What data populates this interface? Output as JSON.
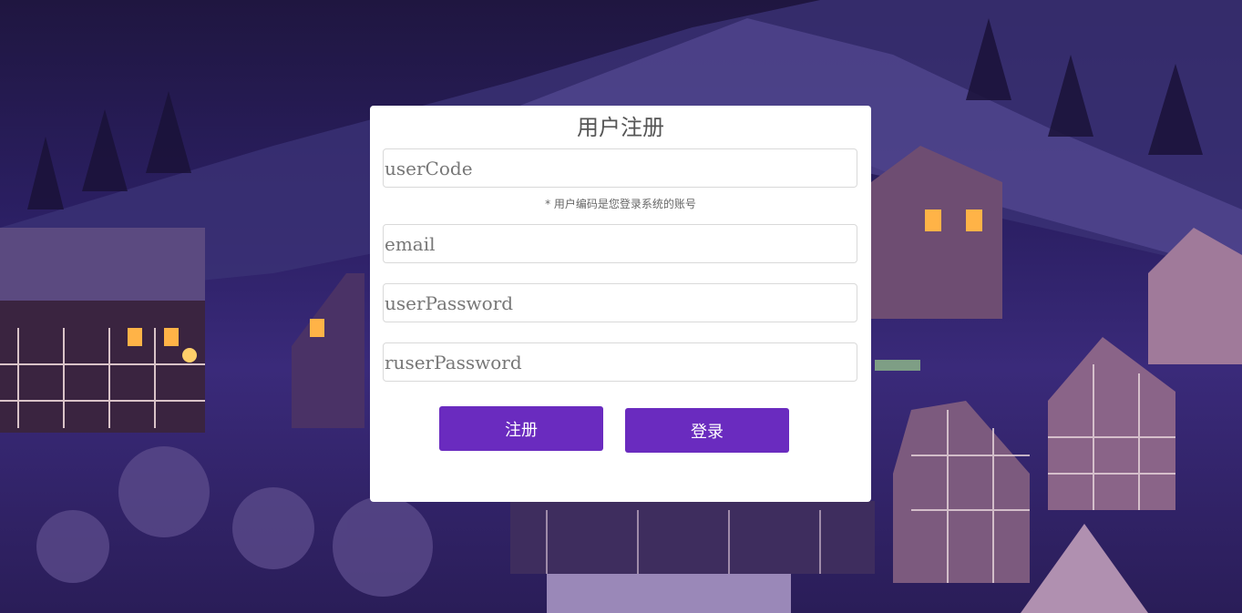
{
  "page": {
    "title": "用户注册"
  },
  "form": {
    "user_code_placeholder": "userCode",
    "user_code_hint": "* 用户编码是您登录系统的账号",
    "email_placeholder": "email",
    "password_placeholder": "userPassword",
    "repeat_password_placeholder": "ruserPassword"
  },
  "actions": {
    "register_label": "注册",
    "login_label": "登录"
  },
  "colors": {
    "accent": "#6a2bbf",
    "card_background": "#ffffff",
    "background_night": "#2b1f63"
  }
}
